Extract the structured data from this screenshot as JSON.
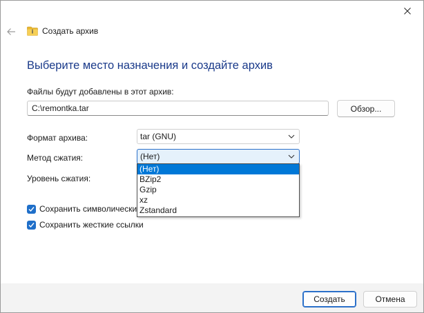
{
  "window": {
    "title": "Создать архив",
    "heading": "Выберите место назначения и создайте архив"
  },
  "icons": {
    "back": "back-arrow-icon",
    "folder": "folder-archive-icon",
    "close": "close-icon",
    "chevron": "chevron-down-icon",
    "check": "checkmark-icon"
  },
  "files": {
    "label": "Файлы будут добавлены в этот архив:",
    "path": "C:\\remontka.tar",
    "browse_label": "Обзор..."
  },
  "format": {
    "label": "Формат архива:",
    "value": "tar (GNU)"
  },
  "method": {
    "label": "Метод сжатия:",
    "value": "(Нет)",
    "options": [
      "(Нет)",
      "BZip2",
      "Gzip",
      "xz",
      "Zstandard"
    ],
    "selected_index": 0
  },
  "level": {
    "label": "Уровень сжатия:"
  },
  "checkboxes": {
    "symlinks_label": "Сохранить символические",
    "symlinks_checked": true,
    "hardlinks_label": "Сохранить жесткие ссылки",
    "hardlinks_checked": true
  },
  "footer": {
    "create_label": "Создать",
    "cancel_label": "Отмена"
  },
  "colors": {
    "accent": "#0078d7",
    "heading": "#1a3a8a"
  }
}
